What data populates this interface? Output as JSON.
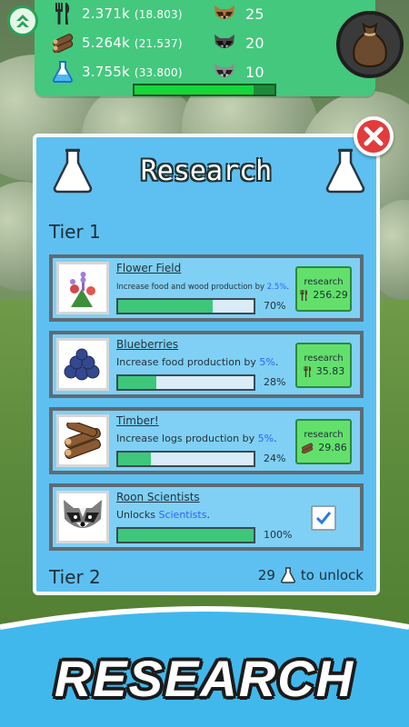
{
  "hud": {
    "food": {
      "value": "2.371k",
      "total": "(18.803)"
    },
    "wood": {
      "value": "5.264k",
      "total": "(21.537)"
    },
    "science": {
      "value": "3.755k",
      "total": "(33.800)"
    },
    "raccoons": [
      {
        "count": "25",
        "icon": "brown-raccoon-icon"
      },
      {
        "count": "20",
        "icon": "gray-raccoon-icon"
      },
      {
        "count": "10",
        "icon": "scientist-raccoon-icon"
      }
    ],
    "progress": 0.85
  },
  "panel": {
    "title": "Research",
    "tier1": "Tier 1",
    "tier2": "Tier 2",
    "unlock": {
      "count": "29",
      "label": "to unlock"
    },
    "cards": [
      {
        "name": "Flower Field",
        "desc_prefix": "Increase food and wood production by ",
        "highlight": "2.5%",
        "desc_suffix": ".",
        "progress": 70,
        "pct_label": "70%",
        "button_label": "research",
        "cost": "256.29",
        "cost_icon": "fork-knife-icon"
      },
      {
        "name": "Blueberries",
        "desc_prefix": "Increase food production by ",
        "highlight": "5%",
        "desc_suffix": ".",
        "progress": 28,
        "pct_label": "28%",
        "button_label": "research",
        "cost": "35.83",
        "cost_icon": "fork-knife-icon"
      },
      {
        "name": "Timber!",
        "desc_prefix": "Increase logs production by ",
        "highlight": "5%",
        "desc_suffix": ".",
        "progress": 24,
        "pct_label": "24%",
        "button_label": "research",
        "cost": "29.86",
        "cost_icon": "logs-icon"
      },
      {
        "name": "Roon Scientists",
        "desc_prefix": "Unlocks ",
        "highlight": "Scientists",
        "desc_suffix": ".",
        "progress": 100,
        "pct_label": "100%",
        "completed": true
      }
    ]
  },
  "banner": {
    "title": "RESEARCH"
  },
  "colors": {
    "hud": "#43c87d",
    "panel": "#5ec0f0",
    "card": "#7fd0f4",
    "button": "#63e06b",
    "highlight": "#2c64ff",
    "banner": "#41b8ec"
  }
}
